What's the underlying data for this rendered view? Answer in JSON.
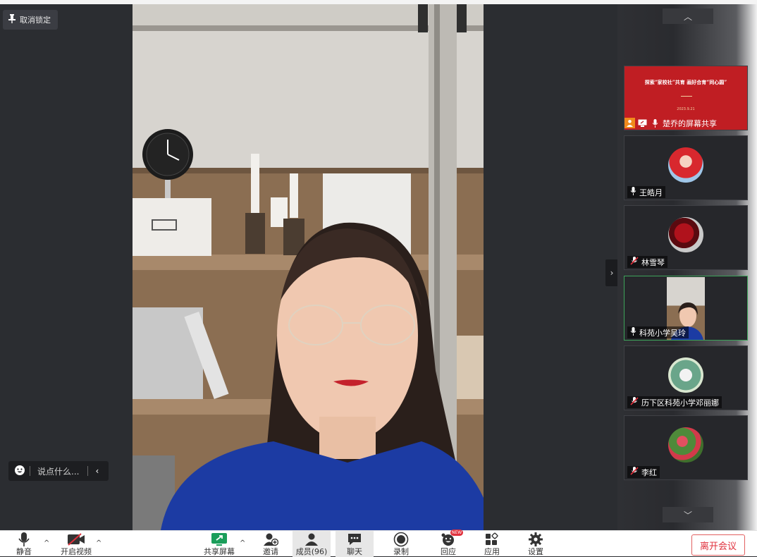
{
  "top": {
    "unlock_label": "取消锁定"
  },
  "comment": {
    "placeholder": "说点什么..."
  },
  "sidebar": {
    "share": {
      "title": "探索“家校社”共育 画好合育“同心圆”",
      "date": "2023.9.21",
      "name": "楚乔的屏幕共享"
    },
    "participants": [
      {
        "name": "王皓月",
        "muted": false
      },
      {
        "name": "林雪琴",
        "muted": true
      },
      {
        "name": "科苑小学吴玲",
        "muted": false,
        "active": true
      },
      {
        "name": "历下区科苑小学邓丽娜",
        "muted": true
      },
      {
        "name": "李红",
        "muted": true
      }
    ]
  },
  "toolbar": {
    "mute": "静音",
    "start_video": "开启视频",
    "share_screen": "共享屏幕",
    "invite": "邀请",
    "members": "成员(96)",
    "chat": "聊天",
    "record": "录制",
    "reactions": "回应",
    "apps": "应用",
    "settings": "设置",
    "new_badge": "NEW",
    "leave": "离开会议"
  },
  "colors": {
    "leave": "#e0303c",
    "active_border": "#3da35a",
    "share_bg": "#c01e23"
  }
}
